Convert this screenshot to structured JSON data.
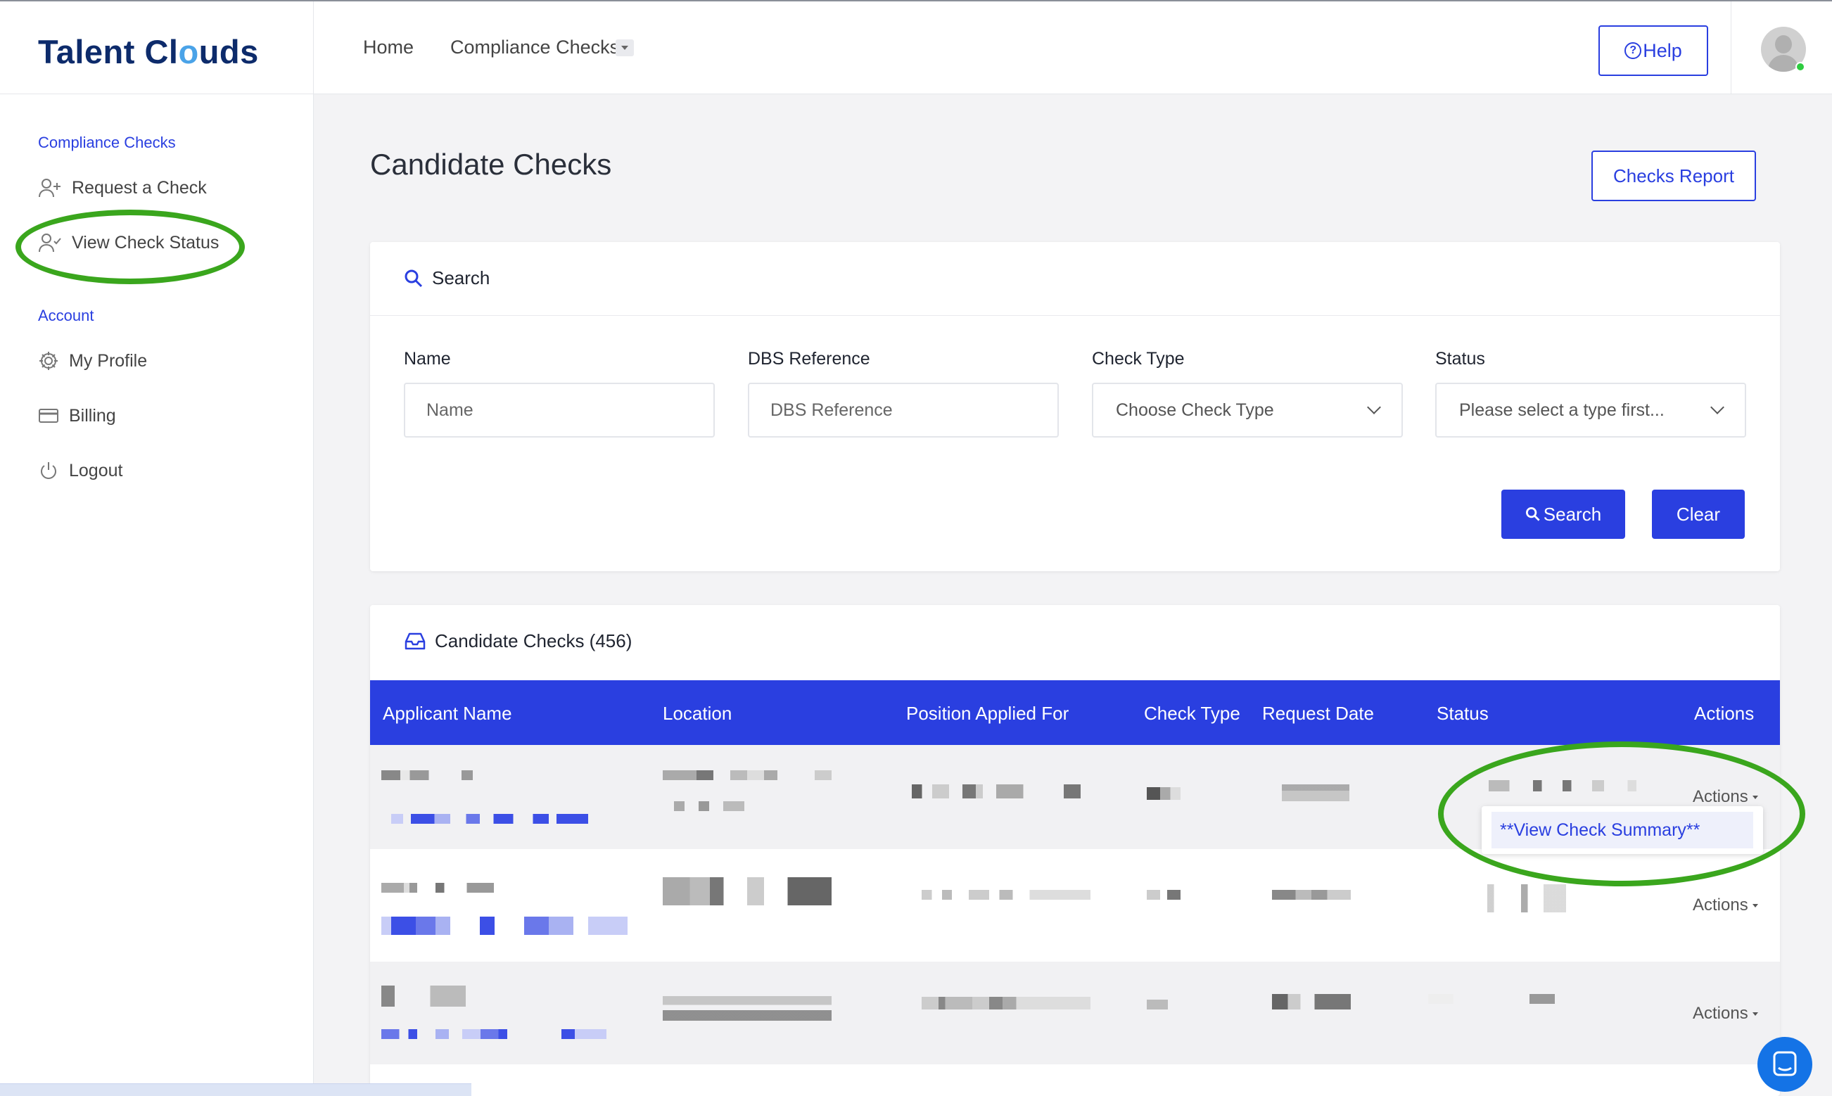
{
  "app": {
    "logo_pre": "Talent Cl",
    "logo_o": "o",
    "logo_post": "uds"
  },
  "nav": {
    "home": "Home",
    "compliance_checks": "Compliance Checks",
    "help": "Help"
  },
  "sidebar": {
    "section_compliance": "Compliance Checks",
    "section_account": "Account",
    "items": [
      {
        "label": "Request a Check",
        "icon": "user-plus-icon"
      },
      {
        "label": "View Check Status",
        "icon": "user-check-icon"
      },
      {
        "label": "My Profile",
        "icon": "gear-icon"
      },
      {
        "label": "Billing",
        "icon": "credit-card-icon"
      },
      {
        "label": "Logout",
        "icon": "power-icon"
      }
    ]
  },
  "page": {
    "title": "Candidate Checks",
    "report_button": "Checks Report"
  },
  "search": {
    "heading": "Search",
    "name_label": "Name",
    "name_placeholder": "Name",
    "dbs_label": "DBS Reference",
    "dbs_placeholder": "DBS Reference",
    "type_label": "Check Type",
    "type_value": "Choose Check Type",
    "status_label": "Status",
    "status_value": "Please select a type first...",
    "search_button": "Search",
    "clear_button": "Clear"
  },
  "table": {
    "heading": "Candidate Checks (456)",
    "columns": [
      "Applicant Name",
      "Location",
      "Position Applied For",
      "Check Type",
      "Request Date",
      "Status",
      "Actions"
    ],
    "row_action": "Actions",
    "dropdown_item": "**View Check Summary**"
  },
  "colors": {
    "primary": "#2a3fe0",
    "brand": "#0d2b6b",
    "highlight_ring": "#3aa61d"
  }
}
